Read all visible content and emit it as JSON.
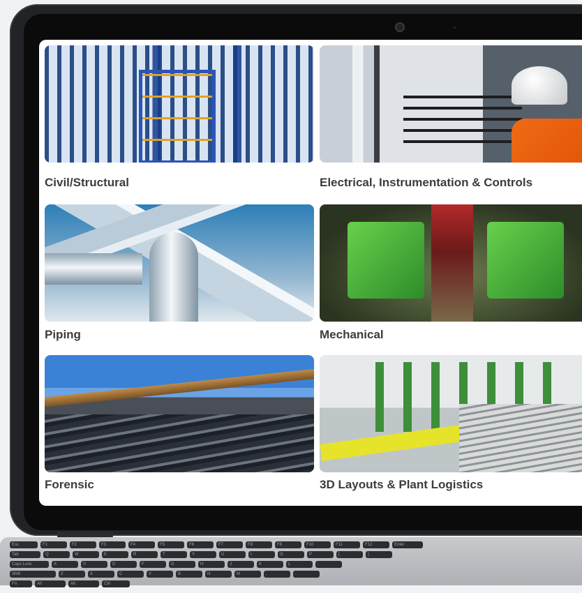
{
  "tiles": [
    {
      "id": "civil",
      "label": "Civil/Structural"
    },
    {
      "id": "electrical",
      "label": "Electrical, Instrumentation & Controls"
    },
    {
      "id": "piping",
      "label": "Piping"
    },
    {
      "id": "mechanical",
      "label": "Mechanical"
    },
    {
      "id": "forensic",
      "label": "Forensic"
    },
    {
      "id": "layouts",
      "label": "3D Layouts & Plant Logistics"
    }
  ],
  "keyboard": {
    "row1": [
      "Esc",
      "F1",
      "F2",
      "F3",
      "F4",
      "F5",
      "F6",
      "F7",
      "F8",
      "F9",
      "F10",
      "F11",
      "F12",
      "Enter"
    ],
    "row2": [
      "Tab",
      "Q",
      "W",
      "E",
      "R",
      "T",
      "Y",
      "U",
      "I",
      "O",
      "P",
      "[",
      "]"
    ],
    "row3": [
      "Caps Lock",
      "A",
      "S",
      "D",
      "F",
      "G",
      "H",
      "J",
      "K",
      "L",
      ";"
    ],
    "row4": [
      "Shift",
      "Z",
      "X",
      "C",
      "V",
      "B",
      "N",
      "M",
      ",",
      "."
    ],
    "row5": [
      "Fn",
      "Alt",
      "Alt",
      "Ctrl"
    ]
  },
  "colors": {
    "caption": "#3c3c3c",
    "bezel": "#222326",
    "screen_bg": "#ffffff",
    "page_bg": "#f1f2f4"
  }
}
